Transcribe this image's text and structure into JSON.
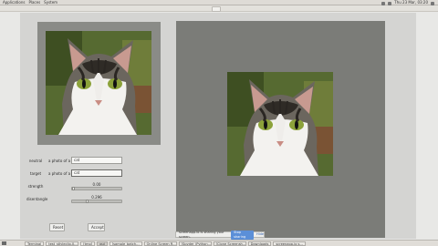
{
  "topbar": {
    "menus": [
      "Applications",
      "Places",
      "System"
    ],
    "clock": "Thu 23 Mar, 03:20"
  },
  "form": {
    "neutral_label": "neutral",
    "neutral_prefix": "a photo of a",
    "neutral_value": "cat",
    "target_label": "target",
    "target_prefix": "a photo of a",
    "target_value": "cat",
    "strength_label": "strength",
    "strength_value": "0.00",
    "strength_fraction": 0.0,
    "disentangle_label": "disentangle",
    "disentangle_value": "0.296",
    "disentangle_fraction": 0.3,
    "reset_label": "Reset",
    "accept_label": "Accept"
  },
  "share_bar": {
    "message": "screenapp.io is sharing your screen.",
    "stop_label": "Stop sharing",
    "hide_label": "Hide"
  },
  "taskbar": {
    "tasks": [
      {
        "label": "Terminal"
      },
      {
        "label": "test_stlyleclip.0..."
      },
      {
        "label": "[tmp]"
      },
      {
        "label": "gui"
      },
      {
        "label": "[sample_batch..."
      },
      {
        "label": "Online Screen R..."
      },
      {
        "label": "[Spyder (Python..."
      },
      {
        "label": "[Clone Screensh..."
      },
      {
        "label": "Downloads"
      },
      {
        "label": "screenapp.io s..."
      }
    ]
  }
}
